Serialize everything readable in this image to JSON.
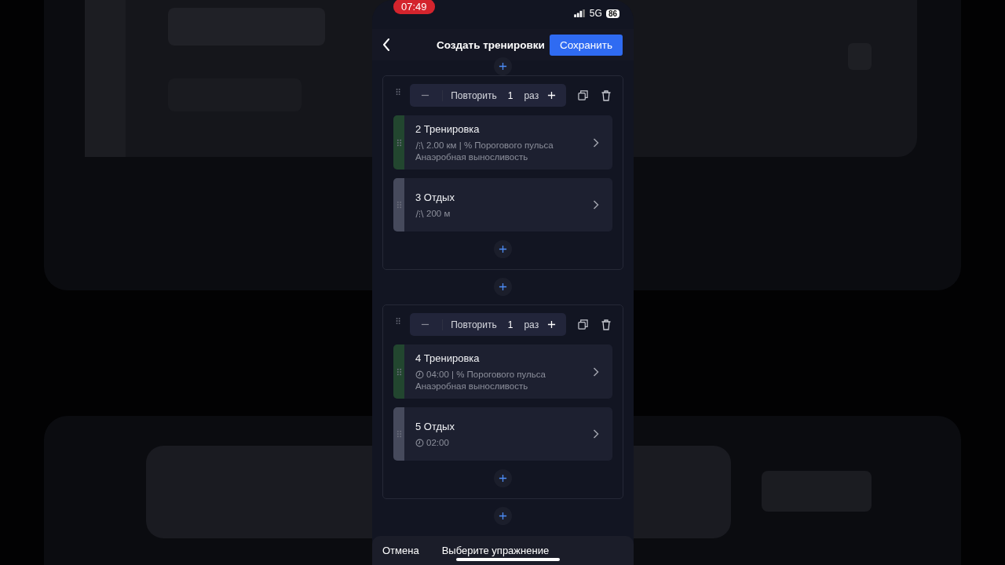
{
  "status_bar": {
    "time": "07:49",
    "network": "5G",
    "battery": "86"
  },
  "header": {
    "title": "Создать тренировки",
    "save_button": "Сохранить"
  },
  "blocks": [
    {
      "repeat_label": "Повторить",
      "count": "1",
      "unit": "раз",
      "steps": [
        {
          "kind": "work",
          "title": "2 Тренировка",
          "metric": {
            "kind": "distance",
            "text": "2.00 км | % Порогового пульса"
          },
          "zone": "Анаэробная выносливость"
        },
        {
          "kind": "rest",
          "title": "3 Отдых",
          "metric": {
            "kind": "distance",
            "text": "200 м"
          }
        }
      ]
    },
    {
      "repeat_label": "Повторить",
      "count": "1",
      "unit": "раз",
      "steps": [
        {
          "kind": "work",
          "title": "4 Тренировка",
          "metric": {
            "kind": "time",
            "text": "04:00 | % Порогового пульса"
          },
          "zone": "Анаэробная выносливость"
        },
        {
          "kind": "rest",
          "title": "5 Отдых",
          "metric": {
            "kind": "time",
            "text": "02:00"
          }
        }
      ]
    }
  ],
  "bottom_sheet": {
    "cancel": "Отмена",
    "title": "Выберите упражнение"
  }
}
